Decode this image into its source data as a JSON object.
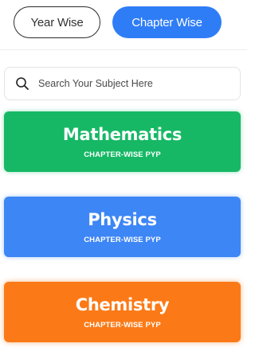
{
  "toggle": {
    "year_label": "Year Wise",
    "chapter_label": "Chapter Wise"
  },
  "search": {
    "placeholder": "Search Your Subject Here",
    "icon": "search-icon"
  },
  "subjects": [
    {
      "title": "Mathematics",
      "subtitle": "CHAPTER-WISE PYP",
      "color": "#16b865"
    },
    {
      "title": "Physics",
      "subtitle": "CHAPTER-WISE PYP",
      "color": "#3d86f5"
    },
    {
      "title": "Chemistry",
      "subtitle": "CHAPTER-WISE PYP",
      "color": "#fb7a17"
    }
  ],
  "colors": {
    "accent": "#2f7df6"
  }
}
